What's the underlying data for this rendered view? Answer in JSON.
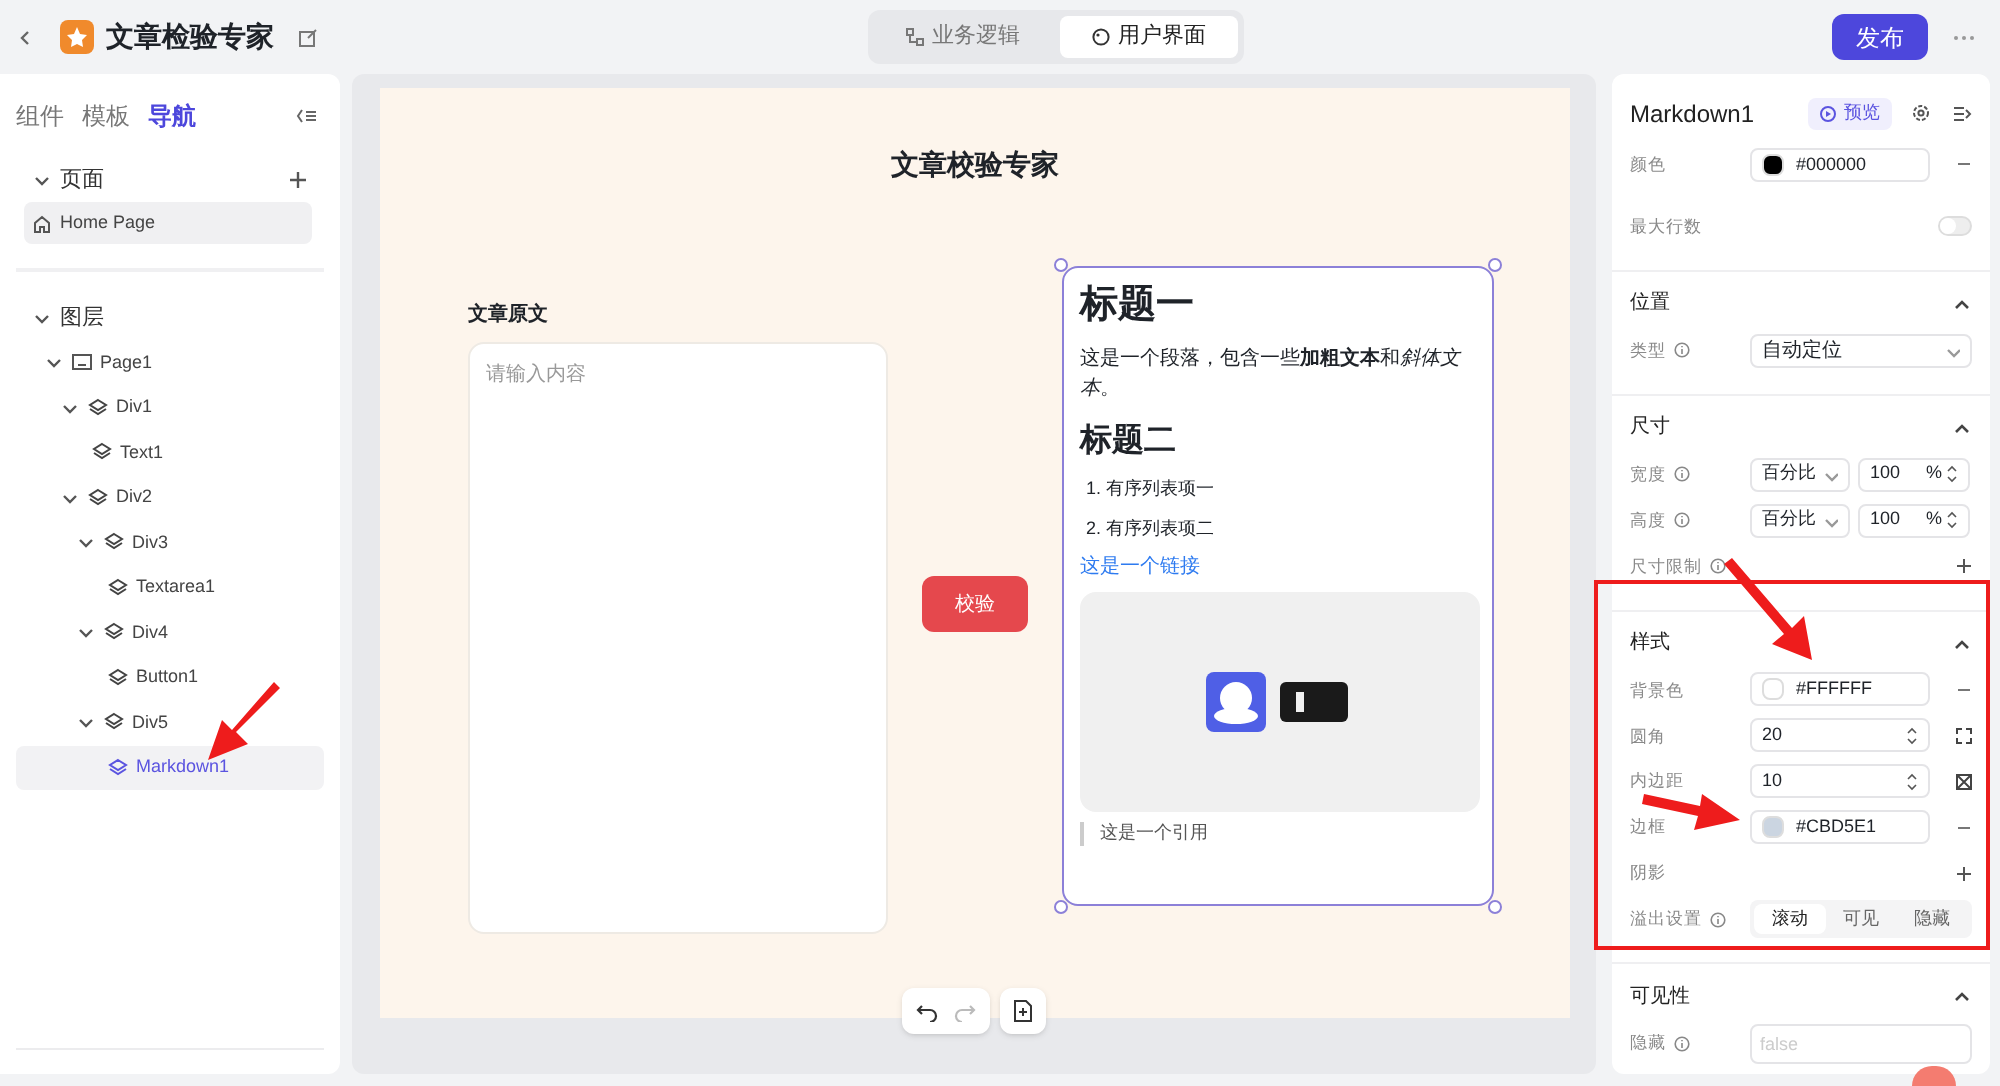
{
  "header": {
    "title": "文章检验专家",
    "tabs": [
      {
        "label": "业务逻辑",
        "selected": false
      },
      {
        "label": "用户界面",
        "selected": true
      }
    ],
    "publish": "发布"
  },
  "left": {
    "tabs": [
      {
        "label": "组件",
        "selected": false
      },
      {
        "label": "模板",
        "selected": false
      },
      {
        "label": "导航",
        "selected": true
      }
    ],
    "pages": {
      "title": "页面",
      "expanded": true,
      "items": [
        {
          "label": "Home Page",
          "selected": true
        }
      ]
    },
    "layers": {
      "title": "图层",
      "expanded": true,
      "tree": [
        {
          "label": "Page1",
          "kind": "page",
          "expanded": true,
          "selected": false,
          "children": [
            {
              "label": "Div1",
              "kind": "block",
              "expanded": true,
              "selected": false,
              "children": [
                {
                  "label": "Text1",
                  "kind": "block",
                  "selected": false
                }
              ]
            },
            {
              "label": "Div2",
              "kind": "block",
              "expanded": true,
              "selected": false,
              "children": [
                {
                  "label": "Div3",
                  "kind": "block",
                  "expanded": true,
                  "selected": false,
                  "children": [
                    {
                      "label": "Textarea1",
                      "kind": "block",
                      "selected": false
                    }
                  ]
                },
                {
                  "label": "Div4",
                  "kind": "block",
                  "expanded": true,
                  "selected": false,
                  "children": [
                    {
                      "label": "Button1",
                      "kind": "block",
                      "selected": false
                    }
                  ]
                },
                {
                  "label": "Div5",
                  "kind": "block",
                  "expanded": true,
                  "selected": false,
                  "children": [
                    {
                      "label": "Markdown1",
                      "kind": "block",
                      "selected": true
                    }
                  ]
                }
              ]
            }
          ]
        }
      ]
    }
  },
  "canvas": {
    "title": "文章校验专家",
    "input_label": "文章原文",
    "textarea_placeholder": "请输入内容",
    "button": "校验",
    "markdown": {
      "h1": "标题一",
      "paragraph": [
        {
          "kind": "plain",
          "text": "这是一个段落，包含一些"
        },
        {
          "kind": "bold",
          "text": "加粗文本"
        },
        {
          "kind": "plain",
          "text": "和"
        },
        {
          "kind": "italic",
          "text": "斜体文本"
        },
        {
          "kind": "plain",
          "text": "。"
        }
      ],
      "h2": "标题二",
      "list": [
        {
          "number": "1.",
          "text": "有序列表项一"
        },
        {
          "number": "2.",
          "text": "有序列表项二"
        }
      ],
      "link": "这是一个链接",
      "quote": "这是一个引用"
    }
  },
  "right": {
    "title": "Markdown1",
    "preview": "预览",
    "top_rows": [
      {
        "kind": "color",
        "label": "颜色",
        "info": false,
        "value": "#000000",
        "color": "#000000"
      },
      {
        "kind": "toggle",
        "label": "最大行数",
        "info": false,
        "on": false
      }
    ],
    "sections": [
      {
        "title": "位置",
        "expanded": true,
        "rows": [
          {
            "kind": "select",
            "label": "类型",
            "info": true,
            "value": "自动定位"
          }
        ]
      },
      {
        "title": "尺寸",
        "expanded": true,
        "rows": [
          {
            "kind": "size",
            "label": "宽度",
            "info": true,
            "unit_type": "百分比",
            "value": "100",
            "unit": "%"
          },
          {
            "kind": "size",
            "label": "高度",
            "info": true,
            "unit_type": "百分比",
            "value": "100",
            "unit": "%"
          },
          {
            "kind": "add",
            "label": "尺寸限制",
            "info": true
          }
        ]
      },
      {
        "title": "样式",
        "expanded": true,
        "rows": [
          {
            "kind": "color",
            "label": "背景色",
            "info": false,
            "value": "#FFFFFF",
            "color": "#ffffff"
          },
          {
            "kind": "radius",
            "label": "圆角",
            "info": false,
            "value": "20"
          },
          {
            "kind": "padding",
            "label": "内边距",
            "info": false,
            "value": "10"
          },
          {
            "kind": "color",
            "label": "边框",
            "info": false,
            "value": "#CBD5E1",
            "color": "#cbd5e1"
          },
          {
            "kind": "add",
            "label": "阴影",
            "info": false
          },
          {
            "kind": "segmented",
            "label": "溢出设置",
            "info": true,
            "options": [
              {
                "label": "滚动",
                "selected": true
              },
              {
                "label": "可见",
                "selected": false
              },
              {
                "label": "隐藏",
                "selected": false
              }
            ]
          }
        ]
      },
      {
        "title": "可见性",
        "expanded": true,
        "rows": [
          {
            "kind": "input",
            "label": "隐藏",
            "info": true,
            "placeholder": "false"
          }
        ]
      }
    ]
  }
}
